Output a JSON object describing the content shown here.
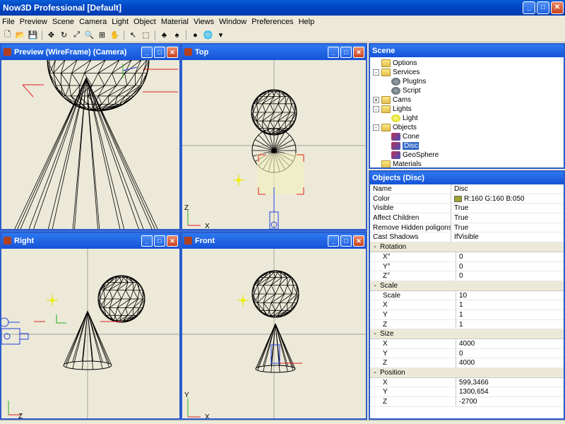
{
  "window": {
    "title": "Now3D Professional [Default]"
  },
  "menu": [
    "File",
    "Preview",
    "Scene",
    "Camera",
    "Light",
    "Object",
    "Material",
    "Views",
    "Window",
    "Preferences",
    "Help"
  ],
  "toolbar_icons": [
    "new-icon",
    "open-icon",
    "save-icon",
    "move-icon",
    "rotate-icon",
    "scale-icon",
    "zoom-icon",
    "fit-icon",
    "pan-icon",
    "select-icon",
    "select-region-icon",
    "render-icon",
    "render-options-icon",
    "sphere-icon",
    "globe-icon",
    "dropdown-icon"
  ],
  "viewports": {
    "preview": {
      "title": "Preview (WireFrame) (Camera)"
    },
    "top": {
      "title": "Top",
      "axis_v": "Z",
      "axis_h": "X"
    },
    "right": {
      "title": "Right",
      "axis_h": "Z"
    },
    "front": {
      "title": "Front",
      "axis_v": "Y",
      "axis_h": "X"
    }
  },
  "scene": {
    "title": "Scene",
    "tree": [
      {
        "label": "Options",
        "level": 1,
        "icon": "folder-icon",
        "expander": ""
      },
      {
        "label": "Services",
        "level": 1,
        "icon": "folder-icon",
        "expander": "-"
      },
      {
        "label": "PlugIns",
        "level": 2,
        "icon": "gear-icon",
        "expander": ""
      },
      {
        "label": "Script",
        "level": 2,
        "icon": "gear-icon",
        "expander": ""
      },
      {
        "label": "Cams",
        "level": 1,
        "icon": "folder-icon",
        "expander": "+"
      },
      {
        "label": "Lights",
        "level": 1,
        "icon": "folder-icon",
        "expander": "-"
      },
      {
        "label": "Light",
        "level": 2,
        "icon": "bulb-icon",
        "expander": ""
      },
      {
        "label": "Objects",
        "level": 1,
        "icon": "folder-icon",
        "expander": "-"
      },
      {
        "label": "Cone",
        "level": 2,
        "icon": "object-icon",
        "expander": ""
      },
      {
        "label": "Disc",
        "level": 2,
        "icon": "object-icon",
        "expander": "",
        "selected": true
      },
      {
        "label": "GeoSphere",
        "level": 2,
        "icon": "object-icon",
        "expander": ""
      },
      {
        "label": "Materials",
        "level": 1,
        "icon": "folder-icon",
        "expander": ""
      }
    ]
  },
  "objects": {
    "title": "Objects (Disc)",
    "rows": [
      {
        "type": "prop",
        "name": "Name",
        "value": "Disc"
      },
      {
        "type": "prop",
        "name": "Color",
        "value": "R:160 G:160 B:050",
        "swatch": "#a0a032"
      },
      {
        "type": "prop",
        "name": "Visible",
        "value": "True"
      },
      {
        "type": "prop",
        "name": "Affect Children",
        "value": "True"
      },
      {
        "type": "prop",
        "name": "Remove Hidden poligons",
        "value": "True"
      },
      {
        "type": "prop",
        "name": "Cast Shadows",
        "value": "IfVisible"
      },
      {
        "type": "cat",
        "name": "Rotation"
      },
      {
        "type": "sub",
        "name": "X°",
        "value": "0"
      },
      {
        "type": "sub",
        "name": "Y°",
        "value": "0"
      },
      {
        "type": "sub",
        "name": "Z°",
        "value": "0"
      },
      {
        "type": "cat",
        "name": "Scale"
      },
      {
        "type": "sub",
        "name": "Scale",
        "value": "10"
      },
      {
        "type": "sub",
        "name": "X",
        "value": "1"
      },
      {
        "type": "sub",
        "name": "Y",
        "value": "1"
      },
      {
        "type": "sub",
        "name": "Z",
        "value": "1"
      },
      {
        "type": "cat",
        "name": "Size"
      },
      {
        "type": "sub",
        "name": "X",
        "value": "4000"
      },
      {
        "type": "sub",
        "name": "Y",
        "value": "0"
      },
      {
        "type": "sub",
        "name": "Z",
        "value": "4000"
      },
      {
        "type": "cat",
        "name": "Position"
      },
      {
        "type": "sub",
        "name": "X",
        "value": "599,3466"
      },
      {
        "type": "sub",
        "name": "Y",
        "value": "1300,654"
      },
      {
        "type": "sub",
        "name": "Z",
        "value": "-2700"
      }
    ]
  },
  "colors": {
    "title_blue": "#1552d8",
    "selection": "#3169c6",
    "wire": "#000000",
    "axis_red": "#e02020",
    "axis_green": "#20b020",
    "axis_blue": "#2040e0",
    "disc_color": "#a0a032"
  }
}
